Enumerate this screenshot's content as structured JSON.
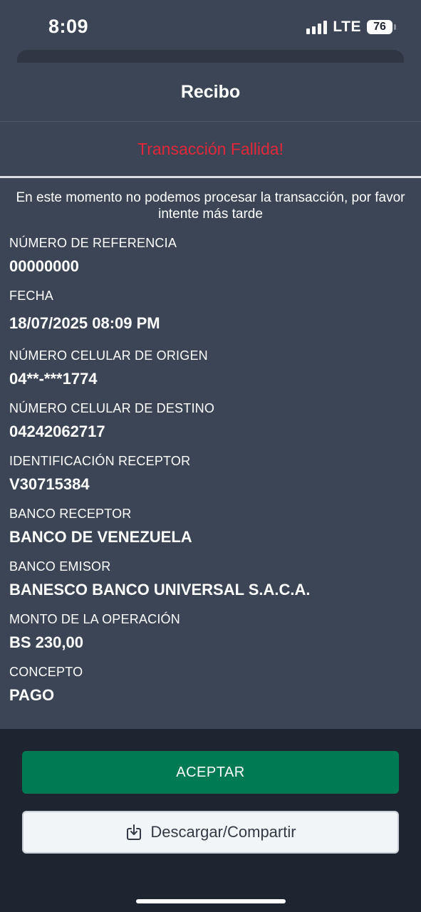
{
  "status_bar": {
    "time": "8:09",
    "network": "LTE",
    "battery": "76"
  },
  "header": {
    "title": "Recibo"
  },
  "transaction_status": "Transacción Fallida!",
  "message": "En este momento no podemos procesar la transacción, por favor intente más tarde",
  "details": [
    {
      "label": "NÚMERO DE REFERENCIA",
      "value": "00000000"
    },
    {
      "label": "FECHA",
      "value": "18/07/2025 08:09 PM"
    },
    {
      "label": "NÚMERO CELULAR DE ORIGEN",
      "value": "04**-***1774"
    },
    {
      "label": "NÚMERO CELULAR DE DESTINO",
      "value": "04242062717"
    },
    {
      "label": "IDENTIFICACIÓN RECEPTOR",
      "value": "V30715384"
    },
    {
      "label": "BANCO RECEPTOR",
      "value": "BANCO DE VENEZUELA"
    },
    {
      "label": "BANCO EMISOR",
      "value": "BANESCO BANCO UNIVERSAL S.A.C.A."
    },
    {
      "label": "MONTO DE LA OPERACIÓN",
      "value": "BS 230,00"
    },
    {
      "label": "CONCEPTO",
      "value": "PAGO"
    }
  ],
  "buttons": {
    "accept_label": "ACEPTAR",
    "share_label": "Descargar/Compartir",
    "share_icon": "download-share-icon"
  },
  "colors": {
    "background": "#3c4555",
    "footer": "#1e2430",
    "error": "#e0283a",
    "accept": "#007a52"
  }
}
